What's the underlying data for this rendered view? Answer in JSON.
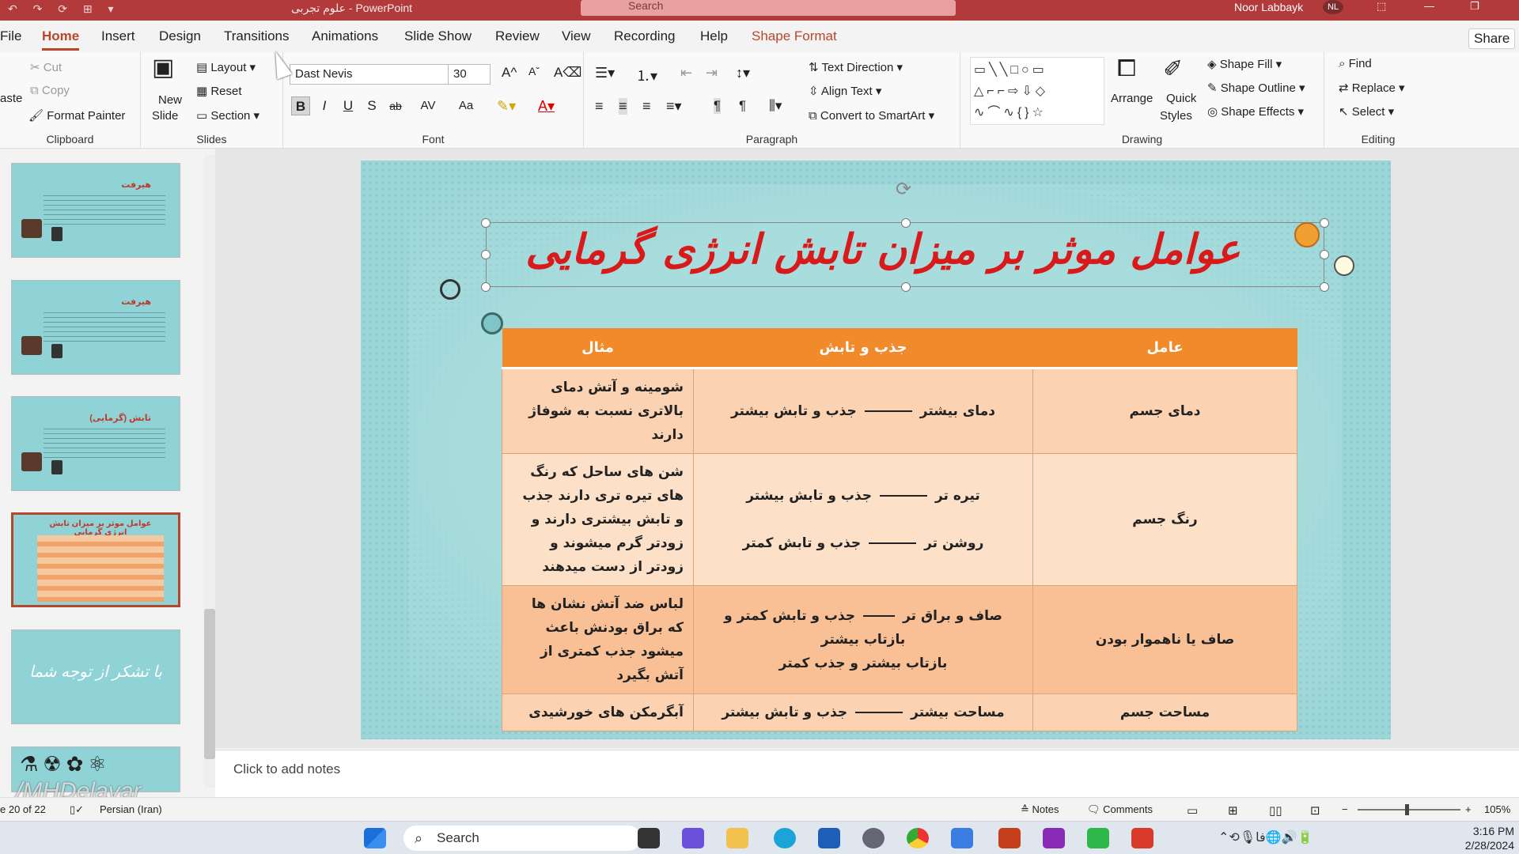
{
  "titlebar": {
    "doc_title": "علوم تجربی  -  PowerPoint",
    "search_placeholder": "Search",
    "user_name": "Noor Labbayk",
    "user_initials": "NL"
  },
  "tabs": [
    "File",
    "Home",
    "Insert",
    "Design",
    "Transitions",
    "Animations",
    "Slide Show",
    "Review",
    "View",
    "Recording",
    "Help",
    "Shape Format"
  ],
  "share_label": "Share",
  "clipboard": {
    "paste": "aste",
    "cut": "Cut",
    "copy": "Copy",
    "format_painter": "Format Painter",
    "label": "Clipboard"
  },
  "slides_group": {
    "new_slide": "New",
    "new_slide2": "Slide",
    "layout": "Layout",
    "reset": "Reset",
    "section": "Section",
    "label": "Slides"
  },
  "font": {
    "name": "Dast Nevis",
    "size": "30",
    "label": "Font",
    "buttons": [
      "B",
      "I",
      "U",
      "S",
      "ab",
      "AV",
      "Aa"
    ]
  },
  "paragraph": {
    "text_direction": "Text Direction",
    "align_text": "Align Text",
    "smartart": "Convert to SmartArt",
    "label": "Paragraph"
  },
  "drawing": {
    "arrange": "Arrange",
    "quick_styles": "Quick",
    "quick_styles2": "Styles",
    "shape_fill": "Shape Fill",
    "shape_outline": "Shape Outline",
    "shape_effects": "Shape Effects",
    "label": "Drawing"
  },
  "editing": {
    "find": "Find",
    "replace": "Replace",
    "select": "Select",
    "label": "Editing"
  },
  "thumbnails": {
    "titles": [
      "هیرفت",
      "هیرفت",
      "تابش (گرمایی)",
      "عوامل موثر بر میزان تابش انرژی گرمایی",
      "با تشکر از توجه شما",
      ""
    ],
    "selected_index": 3
  },
  "slide": {
    "title": "عوامل موثر بر میزان تابش انرژی گرمایی",
    "table": {
      "headers": [
        "عامل",
        "جذب و تابش",
        "مثال"
      ],
      "rows": [
        {
          "factor": "دمای جسم",
          "cause1": "دمای بیشتر",
          "effect1": "جذب و تابش بیشتر",
          "cause2": "",
          "effect2": "",
          "example": "شومینه و آتش دمای بالاتری نسبت به شوفاژ دارند"
        },
        {
          "factor": "رنگ جسم",
          "cause1": "تیره تر",
          "effect1": "جذب و تابش بیشتر",
          "cause2": "روشن تر",
          "effect2": "جذب و تابش کمتر",
          "example": "شن های ساحل که رنگ های تیره تری دارند جذب و تابش بیشتری دارند و زودتر گرم میشوند و زودتر از دست میدهند"
        },
        {
          "factor": "صاف یا ناهموار بودن",
          "cause1": "صاف و براق تر",
          "effect1": "جذب و تابش کمتر و بازتاب بیشتر",
          "cause2": "",
          "effect2": "بازتاب بیشتر و جذب کمتر",
          "example": "لباس ضد آتش نشان ها که براق بودنش باعث میشود جذب کمتری از آتش بگیرد"
        },
        {
          "factor": "مساحت جسم",
          "cause1": "مساحت بیشتر",
          "effect1": "جذب و تابش بیشتر",
          "cause2": "",
          "effect2": "",
          "example": "آبگرمکن های خورشیدی"
        }
      ]
    }
  },
  "notes_placeholder": "Click to add notes",
  "status": {
    "slide_of": "e 20 of 22",
    "language": "Persian (Iran)",
    "notes": "Notes",
    "comments": "Comments",
    "zoom": "105%"
  },
  "taskbar": {
    "search": "Search",
    "time": "3:16 PM",
    "date": "2/28/2024",
    "lang": "فا"
  },
  "watermark": "/MHDelavar",
  "colors": {
    "accent": "#b7472a",
    "title_red": "#d81a1a",
    "table_header": "#f08a2a",
    "slide_bg": "#9dd6d8"
  }
}
